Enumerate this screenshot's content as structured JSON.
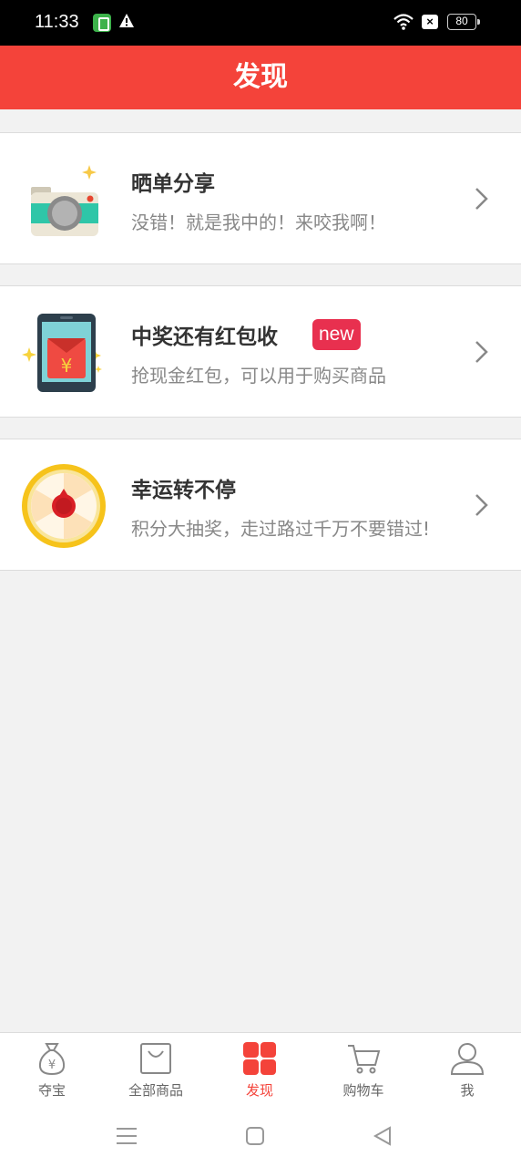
{
  "status_bar": {
    "time": "11:33",
    "battery": "80",
    "icons": [
      "app-icon",
      "warning-icon",
      "wifi-icon",
      "close-icon",
      "battery-icon"
    ]
  },
  "header": {
    "title": "发现"
  },
  "cards": [
    {
      "title": "晒单分享",
      "subtitle": "没错！就是我中的！来咬我啊！",
      "icon": "camera-icon"
    },
    {
      "title": "中奖还有红包收",
      "badge": "new",
      "subtitle": "抢现金红包，可以用于购买商品",
      "icon": "red-envelope-phone-icon"
    },
    {
      "title": "幸运转不停",
      "subtitle": "积分大抽奖，走过路过千万不要错过!",
      "icon": "lucky-wheel-icon"
    }
  ],
  "tab_bar": {
    "tabs": [
      {
        "label": "夺宝",
        "icon": "money-bag-icon"
      },
      {
        "label": "全部商品",
        "icon": "shopping-bag-icon"
      },
      {
        "label": "发现",
        "icon": "grid-icon",
        "active": true
      },
      {
        "label": "购物车",
        "icon": "cart-icon"
      },
      {
        "label": "我",
        "icon": "user-icon"
      }
    ]
  },
  "colors": {
    "brand": "#f4433a",
    "badge": "#e8304f",
    "background": "#f2f2f2"
  }
}
